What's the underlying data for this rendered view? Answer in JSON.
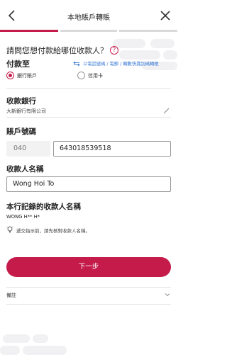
{
  "header": {
    "title": "本地賬戶轉賬"
  },
  "progress": {
    "completed_fraction": 0.33
  },
  "question": {
    "text": "請問您想付款給哪位收款人？",
    "help_glyph": "?"
  },
  "pay_to": {
    "label": "付款至",
    "link": "以電話號碼 / 電郵 / 轉數快識別碼轉賬",
    "options": [
      {
        "label": "銀行賬戶",
        "selected": true
      },
      {
        "label": "信用卡",
        "selected": false
      }
    ]
  },
  "bank": {
    "label": "收款銀行",
    "value": "大新銀行有限公司"
  },
  "account": {
    "label": "賬戶號碼",
    "bank_code": "040",
    "number": "643018539518"
  },
  "payee": {
    "label": "收款人名稱",
    "value": "Wong Hoi To"
  },
  "record": {
    "label": "本行記錄的收款人名稱",
    "value": "WONG H** H*"
  },
  "hint": {
    "text": "遞交指示前，請先核對收款人名稱。"
  },
  "next_button": {
    "label": "下一步"
  },
  "remark": {
    "label": "備註"
  },
  "colors": {
    "accent": "#c41b4b",
    "link": "#3a7bd5",
    "track": "#d9d9d9"
  },
  "icons": [
    "back-arrow-icon",
    "close-icon",
    "help-icon",
    "swap-arrows-icon",
    "pencil-icon",
    "lightbulb-icon",
    "chevron-down-icon"
  ]
}
